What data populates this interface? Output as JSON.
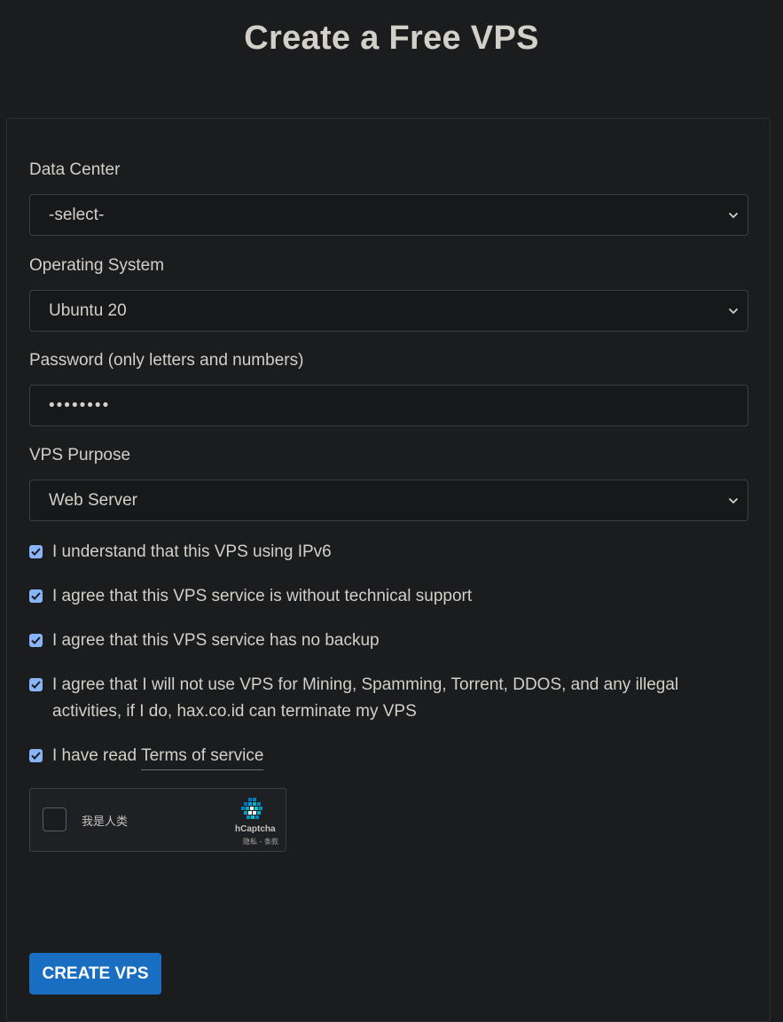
{
  "page": {
    "title": "Create a Free VPS"
  },
  "form": {
    "data_center": {
      "label": "Data Center",
      "value": "-select-"
    },
    "os": {
      "label": "Operating System",
      "value": "Ubuntu 20"
    },
    "password": {
      "label": "Password (only letters and numbers)",
      "masked_value": "••••••••"
    },
    "purpose": {
      "label": "VPS Purpose",
      "value": "Web Server"
    },
    "agreements": [
      {
        "text": "I understand that this VPS using IPv6",
        "checked": true
      },
      {
        "text": "I agree that this VPS service is without technical support",
        "checked": true
      },
      {
        "text": "I agree that this VPS service has no backup",
        "checked": true
      },
      {
        "text": "I agree that I will not use VPS for Mining, Spamming, Torrent, DDOS, and any illegal activities, if I do, hax.co.id can terminate my VPS",
        "checked": true
      },
      {
        "text": "I have read",
        "link": "Terms of service",
        "checked": true
      }
    ],
    "captcha": {
      "label": "我是人类",
      "brand": "hCaptcha",
      "links": "隐私 - 条款"
    },
    "submit_label": "CREATE VPS"
  },
  "colors": {
    "background": "#1b1c1e",
    "text": "#d3cfc9",
    "checkbox": "#8ab4f8",
    "button": "#1a6ec2"
  },
  "icons": [
    "chevron-down-icon",
    "checkmark-icon",
    "hcaptcha-logo-icon"
  ]
}
